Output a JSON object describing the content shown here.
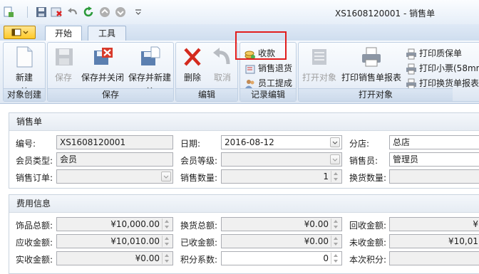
{
  "window": {
    "title": "XS1608120001 - 销售单"
  },
  "tabs": [
    {
      "label": "开始"
    },
    {
      "label": "工具"
    }
  ],
  "ribbon": {
    "groups": {
      "create": {
        "label": "对象创建",
        "new_label": "新建"
      },
      "save": {
        "label": "保存",
        "save_label": "保存",
        "save_close_label": "保存并关闭",
        "save_new_label": "保存并新建"
      },
      "edit": {
        "label": "编辑",
        "delete_label": "删除",
        "cancel_label": "取消"
      },
      "record": {
        "label": "记录编辑",
        "collect_label": "收款",
        "return_label": "销售退货",
        "commission_label": "员工提成"
      },
      "open": {
        "label": "打开对象",
        "open_object_label": "打开对象",
        "print_report_label": "打印销售单报表",
        "print_warranty_label": "打印质保单",
        "print_receipt_label": "打印小票(58mm",
        "print_exchange_label": "打印换货单报表"
      }
    }
  },
  "sales": {
    "header": "销售单",
    "number": {
      "label": "编号:",
      "value": "XS1608120001"
    },
    "date": {
      "label": "日期:",
      "value": "2016-08-12"
    },
    "store": {
      "label": "分店:",
      "value": "总店"
    },
    "member_type": {
      "label": "会员类型:",
      "value": "会员"
    },
    "member_level": {
      "label": "会员等级:",
      "value": ""
    },
    "seller": {
      "label": "销售员:",
      "value": "管理员"
    },
    "order": {
      "label": "销售订单:",
      "value": ""
    },
    "quantity": {
      "label": "销售数量:",
      "value": "1"
    },
    "exchange_qty": {
      "label": "换货数量:",
      "value": ""
    }
  },
  "fees": {
    "header": "费用信息",
    "jewelry_total": {
      "label": "饰品总额:",
      "value": "¥10,000.00"
    },
    "exchange_total": {
      "label": "换货总额:",
      "value": "¥0.00"
    },
    "collected_total": {
      "label": "回收金额:",
      "value": "¥"
    },
    "receivable": {
      "label": "应收金额:",
      "value": "¥10,010.00"
    },
    "received": {
      "label": "已收金额:",
      "value": "¥0.00"
    },
    "uncollected": {
      "label": "未收金额:",
      "value": "¥10,01"
    },
    "actual": {
      "label": "实收金额:",
      "value": "¥0.00"
    },
    "points_factor": {
      "label": "积分系数:",
      "value": "0"
    },
    "points_this": {
      "label": "本次积分:",
      "value": ""
    }
  }
}
